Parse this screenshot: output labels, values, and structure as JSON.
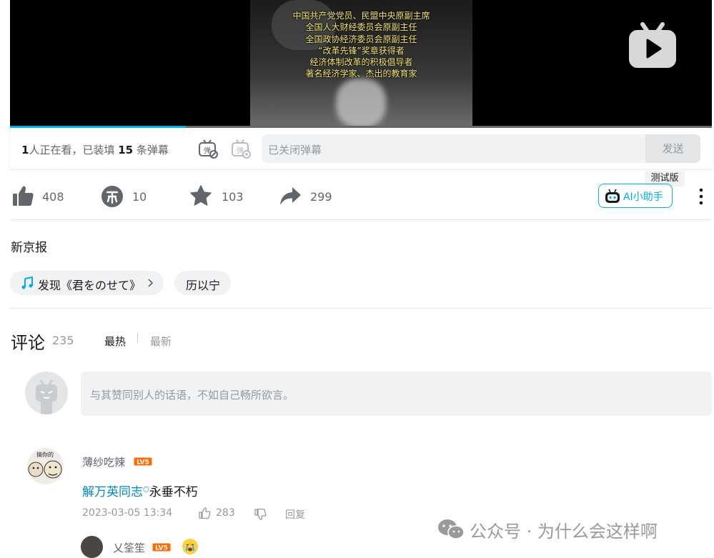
{
  "video": {
    "caption_lines": [
      "中国共产党党员、民盟中央原副主席",
      "全国人大财经委员会原副主任",
      "全国政协经济委员会原副主任",
      "“改革先锋”奖章获得者",
      "经济体制改革的积极倡导者",
      "著名经济学家、杰出的教育家"
    ],
    "progress": 0.25
  },
  "danmaku": {
    "viewers": "1",
    "viewers_text": "人正在看，已装填",
    "count": "15",
    "count_unit": "条弹幕",
    "input_placeholder": "已关闭弹幕",
    "send_label": "发送"
  },
  "actions": {
    "like_count": "408",
    "coin_count": "10",
    "fav_count": "103",
    "share_count": "299",
    "ai_test_tag": "测试版",
    "ai_label": "AI小助手"
  },
  "uploader": "新京报",
  "tags": {
    "music": "发现《君をのせて》",
    "topic": "历以宁"
  },
  "comments": {
    "title": "评论",
    "count": "235",
    "sort_hot": "最热",
    "sort_new": "最新",
    "input_placeholder": "与其赞同别人的话语，不如自己畅所欲言。",
    "level_label": "LV5",
    "items": [
      {
        "user": "薄纱吃辣",
        "avatar_text": "搞你的",
        "link_text": "解万英同志",
        "text": "永垂不朽",
        "date": "2023-03-05 13:34",
        "likes": "283",
        "reply_label": "回复"
      }
    ],
    "sub_user": "乂筌笙"
  },
  "watermark": "公众号 · 为什么会这样啊",
  "colors": {
    "accent": "#00aeec",
    "link": "#008ac5",
    "level": "#ff6b00"
  }
}
